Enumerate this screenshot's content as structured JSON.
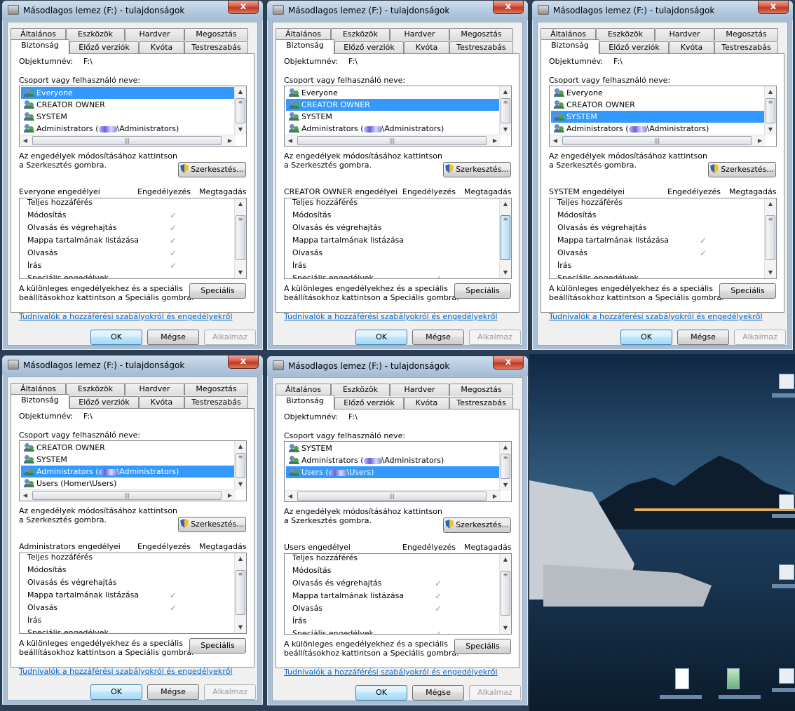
{
  "dialogs": [
    {
      "title": "Másodlagos lemez (F:) - tulajdonságok",
      "close": "x",
      "tabs_row1": [
        "Általános",
        "Eszközök",
        "Hardver",
        "Megosztás"
      ],
      "tabs_row2": [
        "Biztonság",
        "Előző verziók",
        "Kvóta",
        "Testreszabás"
      ],
      "object_label": "Objektumnév:",
      "object_value": "F:\\",
      "group_label": "Csoport vagy felhasználó neve:",
      "users": [
        {
          "name": "Everyone",
          "suffix": ""
        },
        {
          "name": "CREATOR OWNER",
          "suffix": ""
        },
        {
          "name": "SYSTEM",
          "suffix": ""
        },
        {
          "name": "Administrators (",
          "suffix": "\\Administrators)"
        }
      ],
      "selected": 0,
      "edit_note_1": "Az engedélyek módosításához kattintson",
      "edit_note_2": "a Szerkesztés gombra.",
      "edit_button": "Szerkesztés...",
      "perm_title": "Everyone engedélyei",
      "allow_header": "Engedélyezés",
      "deny_header": "Megtagadás",
      "permissions": [
        {
          "name": "Teljes hozzáférés",
          "allow": false,
          "deny": false
        },
        {
          "name": "Módosítás",
          "allow": true,
          "deny": false
        },
        {
          "name": "Olvasás és végrehajtás",
          "allow": true,
          "deny": false
        },
        {
          "name": "Mappa tartalmának listázása",
          "allow": true,
          "deny": false
        },
        {
          "name": "Olvasás",
          "allow": true,
          "deny": false
        },
        {
          "name": "Írás",
          "allow": true,
          "deny": false
        },
        {
          "name": "Speciális engedélyek",
          "allow": false,
          "deny": false
        }
      ],
      "special_note_1": "A különleges engedélyekhez és a speciális",
      "special_note_2": "beállításokhoz kattintson a Speciális gombra.",
      "special_button": "Speciális",
      "info_link": "Tudnivalók a hozzáférési szabályokról és engedélyekről",
      "ok": "OK",
      "cancel": "Mégse",
      "apply": "Alkalmaz"
    },
    {
      "title": "Másodlagos lemez (F:) - tulajdonságok",
      "close": "x",
      "tabs_row1": [
        "Általános",
        "Eszközök",
        "Hardver",
        "Megosztás"
      ],
      "tabs_row2": [
        "Biztonság",
        "Előző verziók",
        "Kvóta",
        "Testreszabás"
      ],
      "object_label": "Objektumnév:",
      "object_value": "F:\\",
      "group_label": "Csoport vagy felhasználó neve:",
      "users": [
        {
          "name": "Everyone",
          "suffix": ""
        },
        {
          "name": "CREATOR OWNER",
          "suffix": ""
        },
        {
          "name": "SYSTEM",
          "suffix": ""
        },
        {
          "name": "Administrators (",
          "suffix": "\\Administrators)"
        }
      ],
      "selected": 1,
      "edit_note_1": "Az engedélyek módosításához kattintson",
      "edit_note_2": "a Szerkesztés gombra.",
      "edit_button": "Szerkesztés...",
      "perm_title": "CREATOR OWNER engedélyei",
      "allow_header": "Engedélyezés",
      "deny_header": "Megtagadás",
      "permissions": [
        {
          "name": "Teljes hozzáférés",
          "allow": false,
          "deny": false
        },
        {
          "name": "Módosítás",
          "allow": false,
          "deny": false
        },
        {
          "name": "Olvasás és végrehajtás",
          "allow": false,
          "deny": false
        },
        {
          "name": "Mappa tartalmának listázása",
          "allow": false,
          "deny": false
        },
        {
          "name": "Olvasás",
          "allow": false,
          "deny": false
        },
        {
          "name": "Írás",
          "allow": false,
          "deny": false
        },
        {
          "name": "Speciális engedélyek",
          "allow": true,
          "deny": false
        }
      ],
      "special_note_1": "A különleges engedélyekhez és a speciális",
      "special_note_2": "beállításokhoz kattintson a Speciális gombra.",
      "special_button": "Speciális",
      "info_link": "Tudnivalók a hozzáférési szabályokról és engedélyekről",
      "ok": "OK",
      "cancel": "Mégse",
      "apply": "Alkalmaz"
    },
    {
      "title": "Másodlagos lemez (F:) - tulajdonságok",
      "close": "x",
      "tabs_row1": [
        "Általános",
        "Eszközök",
        "Hardver",
        "Megosztás"
      ],
      "tabs_row2": [
        "Biztonság",
        "Előző verziók",
        "Kvóta",
        "Testreszabás"
      ],
      "object_label": "Objektumnév:",
      "object_value": "F:\\",
      "group_label": "Csoport vagy felhasználó neve:",
      "users": [
        {
          "name": "Everyone",
          "suffix": ""
        },
        {
          "name": "CREATOR OWNER",
          "suffix": ""
        },
        {
          "name": "SYSTEM",
          "suffix": ""
        },
        {
          "name": "Administrators (",
          "suffix": "\\Administrators)"
        }
      ],
      "selected": 2,
      "edit_note_1": "Az engedélyek módosításához kattintson",
      "edit_note_2": "a Szerkesztés gombra.",
      "edit_button": "Szerkesztés...",
      "perm_title": "SYSTEM engedélyei",
      "allow_header": "Engedélyezés",
      "deny_header": "Megtagadás",
      "permissions": [
        {
          "name": "Teljes hozzáférés",
          "allow": false,
          "deny": false
        },
        {
          "name": "Módosítás",
          "allow": false,
          "deny": false
        },
        {
          "name": "Olvasás és végrehajtás",
          "allow": false,
          "deny": false
        },
        {
          "name": "Mappa tartalmának listázása",
          "allow": false,
          "deny": true
        },
        {
          "name": "Olvasás",
          "allow": false,
          "deny": true
        },
        {
          "name": "Írás",
          "allow": false,
          "deny": false
        },
        {
          "name": "Speciális engedélyek",
          "allow": false,
          "deny": false
        }
      ],
      "special_note_1": "A különleges engedélyekhez és a speciális",
      "special_note_2": "beállításokhoz kattintson a Speciális gombra.",
      "special_button": "Speciális",
      "info_link": "Tudnivalók a hozzáférési szabályokról és engedélyekről",
      "ok": "OK",
      "cancel": "Mégse",
      "apply": "Alkalmaz"
    },
    {
      "title": "Másodlagos lemez (F:) - tulajdonságok",
      "close": "x",
      "tabs_row1": [
        "Általános",
        "Eszközök",
        "Hardver",
        "Megosztás"
      ],
      "tabs_row2": [
        "Biztonság",
        "Előző verziók",
        "Kvóta",
        "Testreszabás"
      ],
      "object_label": "Objektumnév:",
      "object_value": "F:\\",
      "group_label": "Csoport vagy felhasználó neve:",
      "users": [
        {
          "name": "CREATOR OWNER",
          "suffix": ""
        },
        {
          "name": "SYSTEM",
          "suffix": ""
        },
        {
          "name": "Administrators (",
          "suffix": "\\Administrators)"
        },
        {
          "name": "Users (Homer\\Users)",
          "suffix": ""
        }
      ],
      "selected": 2,
      "edit_note_1": "Az engedélyek módosításához kattintson",
      "edit_note_2": "a Szerkesztés gombra.",
      "edit_button": "Szerkesztés...",
      "perm_title": "Administrators engedélyei",
      "allow_header": "Engedélyezés",
      "deny_header": "Megtagadás",
      "permissions": [
        {
          "name": "Teljes hozzáférés",
          "allow": false,
          "deny": false
        },
        {
          "name": "Módosítás",
          "allow": false,
          "deny": false
        },
        {
          "name": "Olvasás és végrehajtás",
          "allow": false,
          "deny": false
        },
        {
          "name": "Mappa tartalmának listázása",
          "allow": true,
          "deny": false
        },
        {
          "name": "Olvasás",
          "allow": true,
          "deny": false
        },
        {
          "name": "Írás",
          "allow": false,
          "deny": false
        },
        {
          "name": "Speciális engedélyek",
          "allow": false,
          "deny": false
        }
      ],
      "special_note_1": "A különleges engedélyekhez és a speciális",
      "special_note_2": "beállításokhoz kattintson a Speciális gombra.",
      "special_button": "Speciális",
      "info_link": "Tudnivalók a hozzáférési szabályokról és engedélyekről",
      "ok": "OK",
      "cancel": "Mégse",
      "apply": "Alkalmaz"
    },
    {
      "title": "Másodlagos lemez (F:) - tulajdonságok",
      "close": "x",
      "tabs_row1": [
        "Általános",
        "Eszközök",
        "Hardver",
        "Megosztás"
      ],
      "tabs_row2": [
        "Biztonság",
        "Előző verziók",
        "Kvóta",
        "Testreszabás"
      ],
      "object_label": "Objektumnév:",
      "object_value": "F:\\",
      "group_label": "Csoport vagy felhasználó neve:",
      "users": [
        {
          "name": "SYSTEM",
          "suffix": ""
        },
        {
          "name": "Administrators (",
          "suffix": "\\Administrators)"
        },
        {
          "name": "Users (",
          "suffix": "\\Users)"
        }
      ],
      "selected": 2,
      "edit_note_1": "Az engedélyek módosításához kattintson",
      "edit_note_2": "a Szerkesztés gombra.",
      "edit_button": "Szerkesztés...",
      "perm_title": "Users engedélyei",
      "allow_header": "Engedélyezés",
      "deny_header": "Megtagadás",
      "permissions": [
        {
          "name": "Teljes hozzáférés",
          "allow": false,
          "deny": false
        },
        {
          "name": "Módosítás",
          "allow": false,
          "deny": false
        },
        {
          "name": "Olvasás és végrehajtás",
          "allow": true,
          "deny": false
        },
        {
          "name": "Mappa tartalmának listázása",
          "allow": true,
          "deny": false
        },
        {
          "name": "Olvasás",
          "allow": true,
          "deny": false
        },
        {
          "name": "Írás",
          "allow": false,
          "deny": false
        },
        {
          "name": "Speciális engedélyek",
          "allow": true,
          "deny": false
        }
      ],
      "special_note_1": "A különleges engedélyekhez és a speciális",
      "special_note_2": "beállításokhoz kattintson a Speciális gombra.",
      "special_button": "Speciális",
      "info_link": "Tudnivalók a hozzáférési szabályokról és engedélyekről",
      "ok": "OK",
      "cancel": "Mégse",
      "apply": "Alkalmaz"
    }
  ],
  "desktop": {
    "icons": [
      "shortcut-icon",
      "shortcut-icon",
      "shortcut-icon",
      "document-icon",
      "recycle-bin-icon"
    ]
  },
  "colors": {
    "selection": "#3399ff",
    "link": "#0066cc",
    "close_button": "#c3361f"
  }
}
